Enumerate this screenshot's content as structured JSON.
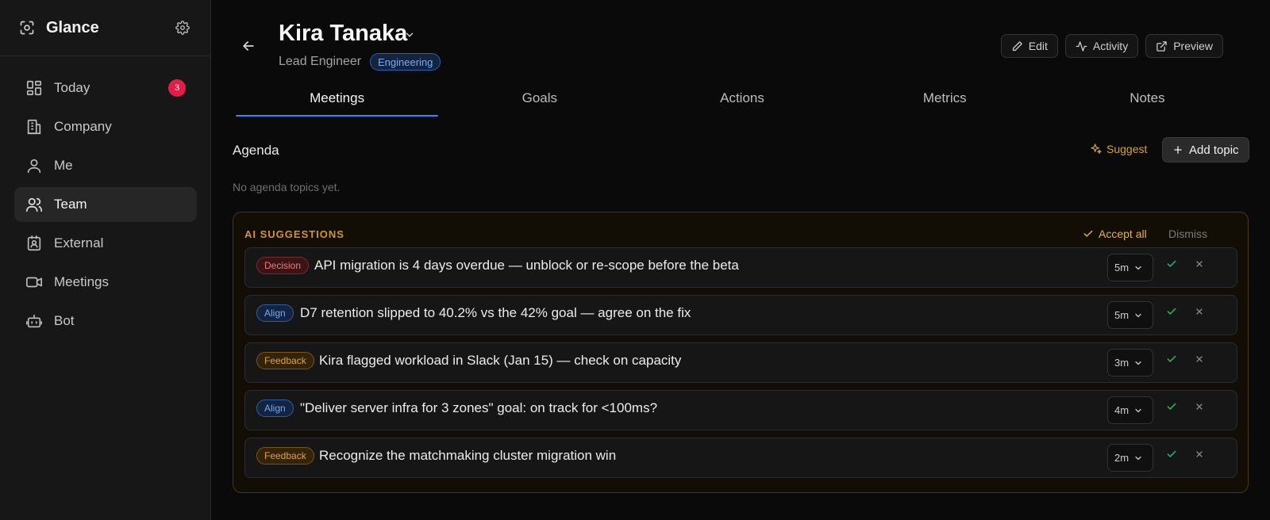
{
  "app": {
    "title": "Glance"
  },
  "sidebar": {
    "items": [
      {
        "label": "Today",
        "icon": "dashboard-icon",
        "badge": "3"
      },
      {
        "label": "Company",
        "icon": "building-icon"
      },
      {
        "label": "Me",
        "icon": "user-icon"
      },
      {
        "label": "Team",
        "icon": "users-icon",
        "active": true
      },
      {
        "label": "External",
        "icon": "contact-card-icon"
      },
      {
        "label": "Meetings",
        "icon": "video-icon"
      },
      {
        "label": "Bot",
        "icon": "bot-icon"
      }
    ]
  },
  "person": {
    "name": "Kira Tanaka",
    "role": "Lead Engineer",
    "department": "Engineering"
  },
  "header_buttons": {
    "edit": "Edit",
    "activity": "Activity",
    "preview": "Preview"
  },
  "tabs": [
    "Meetings",
    "Goals",
    "Actions",
    "Metrics",
    "Notes"
  ],
  "active_tab": "Meetings",
  "agenda": {
    "title": "Agenda",
    "suggest_label": "Suggest",
    "add_topic_label": "Add topic",
    "empty_text": "No agenda topics yet."
  },
  "ai_suggestions": {
    "title": "AI SUGGESTIONS",
    "accept_all_label": "Accept all",
    "dismiss_label": "Dismiss",
    "items": [
      {
        "tag": "Decision",
        "text": "API migration is 4 days overdue — unblock or re-scope before the beta",
        "duration": "5m"
      },
      {
        "tag": "Align",
        "text": "D7 retention slipped to 40.2% vs the 42% goal — agree on the fix",
        "duration": "5m"
      },
      {
        "tag": "Feedback",
        "text": "Kira flagged workload in Slack (Jan 15) — check on capacity",
        "duration": "3m"
      },
      {
        "tag": "Align",
        "text": "\"Deliver server infra for 3 zones\" goal: on track for <100ms?",
        "duration": "4m"
      },
      {
        "tag": "Feedback",
        "text": "Recognize the matchmaking cluster migration win",
        "duration": "2m"
      }
    ]
  },
  "colors": {
    "accent": "#3b82f6",
    "badge": "#e11d48",
    "ai_amber": "#d4932a",
    "accept_green": "#22c55e"
  }
}
